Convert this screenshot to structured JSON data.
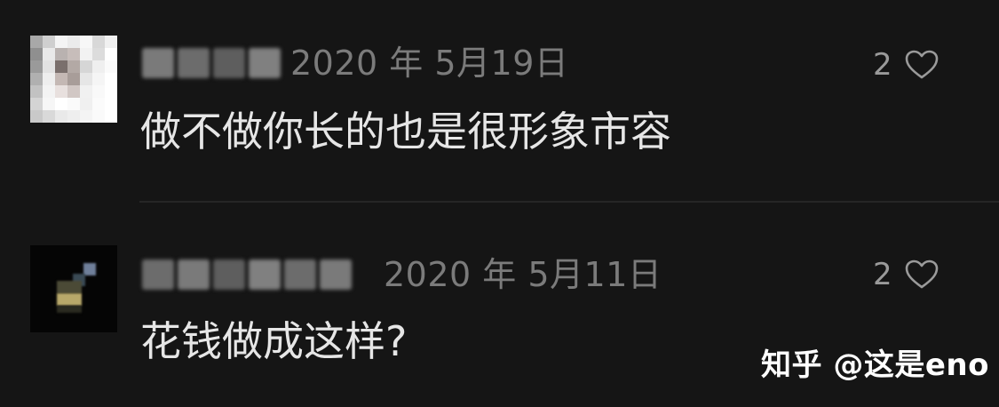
{
  "comments": [
    {
      "username": "小龙女",
      "date": "2020 年 5月19日",
      "likes": "2",
      "text": "做不做你长的也是很形象市容"
    },
    {
      "username": "浮游的舍伴",
      "date": "2020 年 5月11日",
      "likes": "2",
      "text": "花钱做成这样?"
    }
  ],
  "icons": {
    "like": "heart-outline-icon"
  },
  "colors": {
    "background": "#151515",
    "text": "#e6e6e6",
    "meta": "#7b7b7b"
  },
  "watermark": "知乎 @这是eno"
}
